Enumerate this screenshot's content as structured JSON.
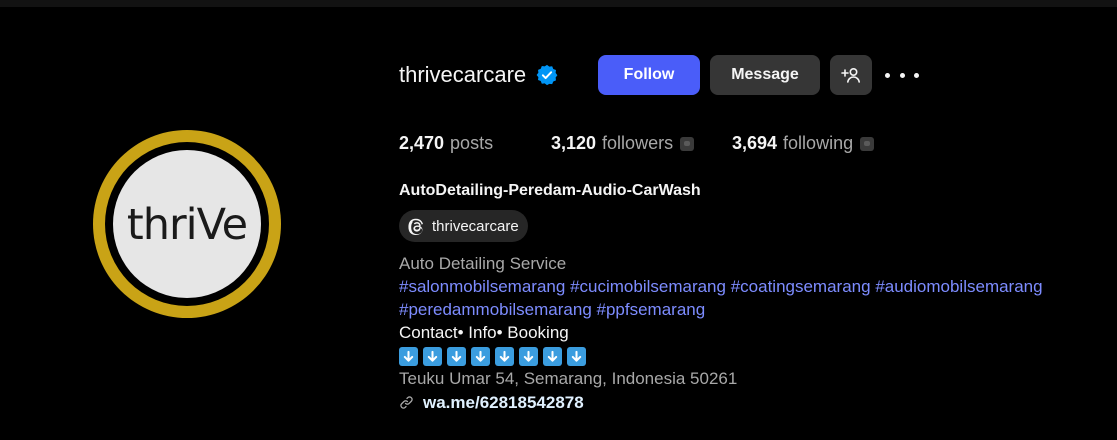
{
  "profile": {
    "username": "thrivecarcare",
    "avatar_text": "thriVe",
    "buttons": {
      "follow": "Follow",
      "message": "Message"
    },
    "stats": {
      "posts_count": "2,470",
      "posts_label": "posts",
      "followers_count": "3,120",
      "followers_label": "followers",
      "following_count": "3,694",
      "following_label": "following"
    },
    "full_name": "AutoDetailing-Peredam-Audio-CarWash",
    "threads_handle": "thrivecarcare",
    "bio": {
      "category": "Auto Detailing Service",
      "hashtags_line1": [
        "#salonmobilsemarang",
        "#cucimobilsemarang",
        "#coatingsemarang",
        "#audiomobilsemarang"
      ],
      "hashtags_line2": [
        "#peredammobilsemarang",
        "#ppfsemarang"
      ],
      "contact_line": "Contact• Info• Booking",
      "arrow_emoji_count": 8,
      "address": "Teuku Umar 54, Semarang, Indonesia 50261",
      "link": "wa.me/62818542878"
    }
  },
  "colors": {
    "background": "#000000",
    "follow_button": "#4a5df9",
    "secondary_button": "#363636",
    "hashtag": "#7d8cff",
    "avatar_ring": "#c9a316",
    "verified_badge": "#0095f6"
  },
  "icons": [
    "verified-badge-icon",
    "add-user-icon",
    "more-options-icon",
    "threads-icon",
    "arrow-down-emoji-icon",
    "link-icon"
  ]
}
